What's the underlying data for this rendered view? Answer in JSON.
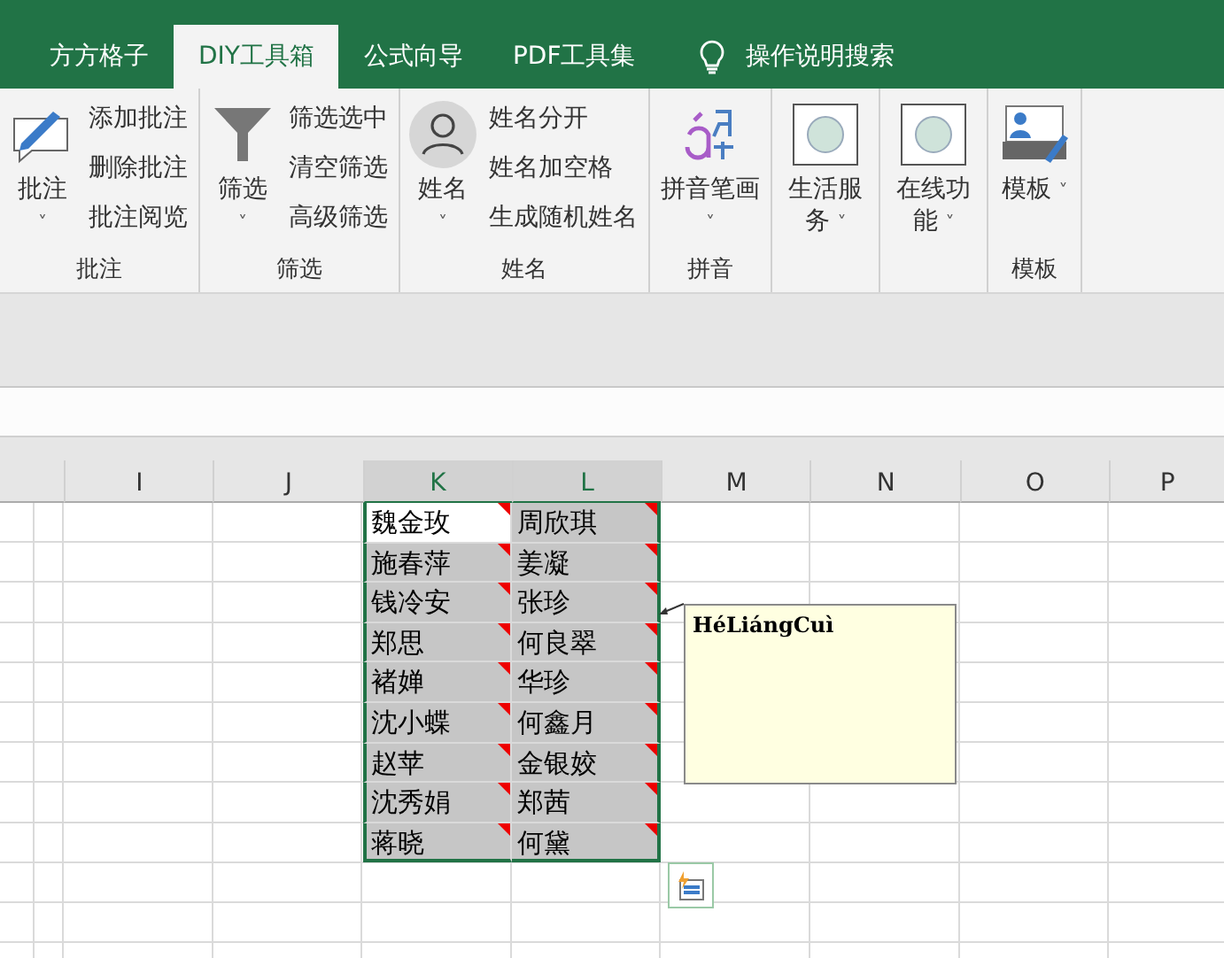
{
  "tabs": [
    {
      "label": "方方格子",
      "selected": false
    },
    {
      "label": "DIY工具箱",
      "selected": true
    },
    {
      "label": "公式向导",
      "selected": false
    },
    {
      "label": "PDF工具集",
      "selected": false
    }
  ],
  "search": {
    "label": "操作说明搜索"
  },
  "ribbon_groups": [
    {
      "label": "批注",
      "big": "批注",
      "caret": "˅",
      "small": [
        "添加批注",
        "删除批注",
        "批注阅览"
      ]
    },
    {
      "label": "筛选",
      "big": "筛选",
      "caret": "˅",
      "small": [
        "筛选选中",
        "清空筛选",
        "高级筛选"
      ]
    },
    {
      "label": "姓名",
      "big": "姓名",
      "caret": "˅",
      "small": [
        "姓名分开",
        "姓名加空格",
        "生成随机姓名"
      ]
    },
    {
      "label": "拼音",
      "big": "拼音笔画",
      "caret": "˅"
    },
    {
      "big": "生活服务",
      "caret": "˅"
    },
    {
      "big": "在线功能",
      "caret": "˅"
    },
    {
      "label": "模板",
      "big": "模板",
      "caret": "˅"
    }
  ],
  "columns": [
    {
      "label": "I",
      "selected": false
    },
    {
      "label": "J",
      "selected": false
    },
    {
      "label": "K",
      "selected": true
    },
    {
      "label": "L",
      "selected": true
    },
    {
      "label": "M",
      "selected": false
    },
    {
      "label": "N",
      "selected": false
    },
    {
      "label": "O",
      "selected": false
    },
    {
      "label": "P",
      "selected": false
    }
  ],
  "rows": [
    {
      "k": "魏金玫",
      "l": "周欣琪",
      "k_active": true
    },
    {
      "k": "施春萍",
      "l": "姜凝",
      "k_active": false
    },
    {
      "k": "钱冷安",
      "l": "张珍",
      "k_active": false
    },
    {
      "k": "郑思",
      "l": "何良翠",
      "k_active": false
    },
    {
      "k": "褚婵",
      "l": "华珍",
      "k_active": false
    },
    {
      "k": "沈小蝶",
      "l": "何鑫月",
      "k_active": false
    },
    {
      "k": "赵苹",
      "l": "金银姣",
      "k_active": false
    },
    {
      "k": "沈秀娟",
      "l": "郑茜",
      "k_active": false
    },
    {
      "k": "蒋晓",
      "l": "何黛",
      "k_active": false
    }
  ],
  "comment": {
    "text": "HéLiángCuì"
  }
}
